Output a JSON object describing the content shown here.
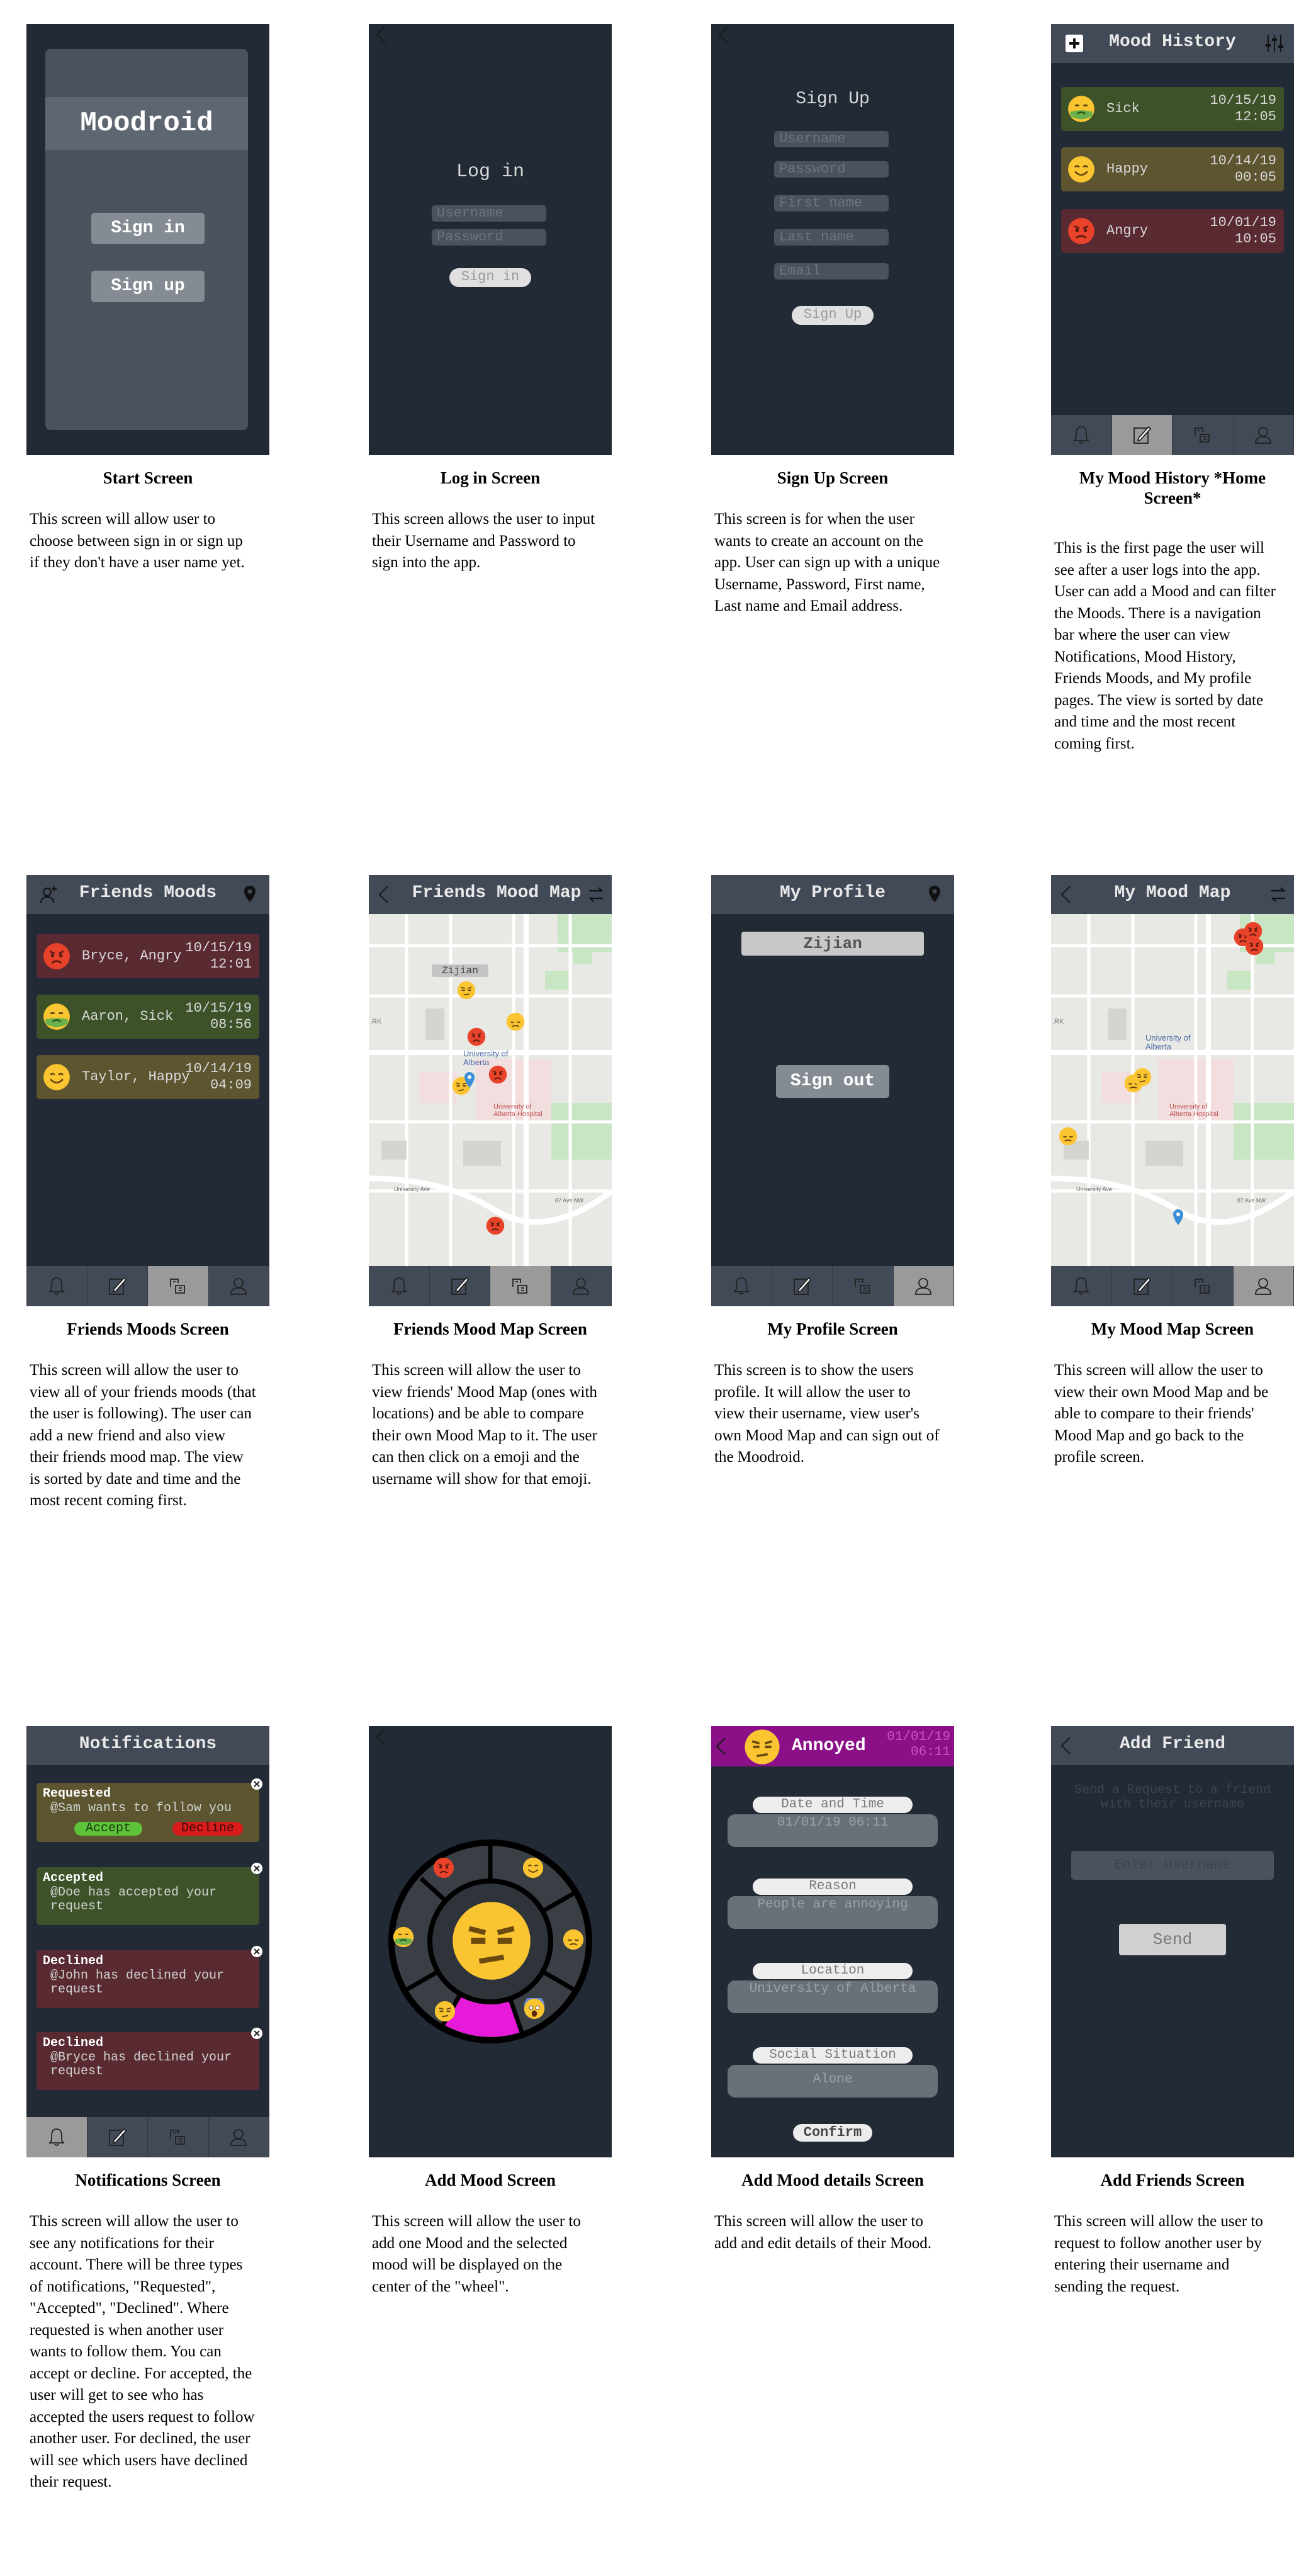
{
  "colors": {
    "phone_bg": "#222a36",
    "bar": "#424a57",
    "sick": "#3d5228",
    "happy": "#5d5530",
    "angry": "#5a2a32",
    "annoyed_header": "#8b1088",
    "wheel_highlight": "#e81ad9"
  },
  "start": {
    "app_title": "Moodroid",
    "signin": "Sign in",
    "signup": "Sign up",
    "caption_title": "Start Screen",
    "caption": "This screen will allow user to choose between sign in or sign up if they don't have a user name yet."
  },
  "login": {
    "title": "Log in",
    "username_ph": "Username",
    "password_ph": "Password",
    "button": "Sign in",
    "caption_title": "Log in Screen",
    "caption": "This screen allows the user to input their Username and Password to sign into the app."
  },
  "signup": {
    "title": "Sign Up",
    "username_ph": "Username",
    "password_ph": "Password",
    "first_ph": "First name",
    "last_ph": "Last name",
    "email_ph": "Email",
    "button": "Sign Up",
    "caption_title": "Sign Up Screen",
    "caption": "This screen is for when the user wants to create an account on the app. User can sign up with a unique Username, Password, First name, Last name and Email address."
  },
  "history": {
    "title": "Mood History",
    "items": [
      {
        "mood": "Sick",
        "date": "10/15/19",
        "time": "12:05"
      },
      {
        "mood": "Happy",
        "date": "10/14/19",
        "time": "00:05"
      },
      {
        "mood": "Angry",
        "date": "10/01/19",
        "time": "10:05"
      }
    ],
    "caption_title": "My Mood History *Home Screen*",
    "caption": "This is the first page the user will see after a user logs into the app. User can add a Mood and can filter the Moods. There is a navigation bar where the user can view Notifications, Mood History, Friends Moods, and My profile pages. The view is sorted by date and time and the most recent coming first."
  },
  "friends": {
    "title": "Friends Moods",
    "items": [
      {
        "label": "Bryce, Angry",
        "date": "10/15/19",
        "time": "12:01"
      },
      {
        "label": "Aaron, Sick",
        "date": "10/15/19",
        "time": "08:56"
      },
      {
        "label": "Taylor, Happy",
        "date": "10/14/19",
        "time": "04:09"
      }
    ],
    "caption_title": "Friends Moods Screen",
    "caption": "This screen will allow the user to view all of your friends moods (that the user is following). The user can add a new friend and also view their friends mood map. The view is sorted by date and time and the most recent coming first."
  },
  "friendsmap": {
    "title": "Friends Mood Map",
    "user_tag": "Zijian",
    "map_label1": "University of Alberta",
    "map_label2": "University of Alberta Hospital",
    "map_road": "University Ave",
    "map_road2": "87 Ave NW",
    "map_edge": ".RK",
    "caption_title": "Friends Mood Map Screen",
    "caption": "This screen will allow the user to view friends' Mood Map (ones with locations) and be able to compare their own Mood Map to it. The user can then click on a emoji and the username will show for that emoji."
  },
  "profile": {
    "title": "My Profile",
    "username": "Zijian",
    "signout": "Sign out",
    "caption_title": "My Profile Screen",
    "caption": "This screen is to show the users profile. It will allow the user to view their username, view user's own Mood Map and can sign out of the Moodroid."
  },
  "mymap": {
    "title": "My Mood Map",
    "map_label1": "University of Alberta",
    "map_label2": "University of Alberta Hospital",
    "map_road": "University Ave",
    "map_road2": "87 Ave NW",
    "map_edge": ".RK",
    "caption_title": "My Mood Map Screen",
    "caption": "This screen will allow the user to view their own Mood Map and be able to compare to their friends' Mood Map and go back to the profile screen."
  },
  "notifications": {
    "title": "Notifications",
    "items": [
      {
        "head": "Requested",
        "body": "@Sam wants to follow you",
        "accept": "Accept",
        "decline": "Decline"
      },
      {
        "head": "Accepted",
        "body": "@Doe has accepted your request"
      },
      {
        "head": "Declined",
        "body": "@John has declined your request"
      },
      {
        "head": "Declined",
        "body": "@Bryce has declined your request"
      }
    ],
    "caption_title": "Notifications Screen",
    "caption": "This screen will allow the user to see any notifications for their account. There will be three types of notifications, \"Requested\", \"Accepted\", \"Declined\". Where requested is when another user wants to follow them. You can accept or decline. For accepted, the user will get to see who has accepted the users request to follow another user. For declined, the user will see which users have declined their request."
  },
  "addmood": {
    "caption_title": "Add Mood Screen",
    "caption": "This screen will allow the user to add one Mood and the selected mood will be displayed on the center of the \"wheel\"."
  },
  "details": {
    "mood": "Annoyed",
    "date": "01/01/19",
    "time": "06:11",
    "labels": [
      "Date and Time",
      "Reason",
      "Location",
      "Social Situation"
    ],
    "values": [
      "01/01/19 06:11",
      "People are annoying",
      "University of Alberta",
      "Alone"
    ],
    "confirm": "Confirm",
    "caption_title": "Add Mood details Screen",
    "caption": "This screen will allow the user to add and edit details of their Mood."
  },
  "addfriend": {
    "title": "Add Friend",
    "hint": "Send a Request to a friend with their username",
    "input_ph": "Enter Username",
    "send": "Send",
    "caption_title": "Add Friends Screen",
    "caption": "This screen will allow the user to request to follow another user by entering their username and sending the request."
  }
}
